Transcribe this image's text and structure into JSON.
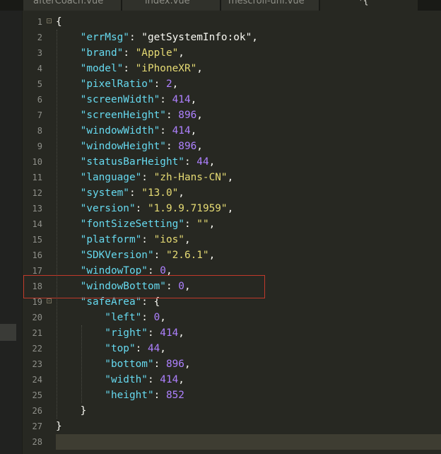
{
  "tabs": [
    {
      "label": "afterCoach.vue",
      "active": false
    },
    {
      "label": "index.vue",
      "active": false
    },
    {
      "label": "mescroll-uni.vue",
      "active": false
    },
    {
      "label": "*{",
      "active": true
    }
  ],
  "lines": [
    {
      "num": "1",
      "code": [
        {
          "t": "p",
          "v": "{"
        }
      ],
      "fold": true
    },
    {
      "num": "2",
      "code": [
        {
          "t": "k",
          "v": "    \"errMsg\""
        },
        {
          "t": "p",
          "v": ": "
        },
        {
          "t": "p",
          "v": "\"getSystemInfo:ok\""
        },
        {
          "t": "p",
          "v": ","
        }
      ]
    },
    {
      "num": "3",
      "code": [
        {
          "t": "k",
          "v": "    \"brand\""
        },
        {
          "t": "p",
          "v": ": "
        },
        {
          "t": "s",
          "v": "\"Apple\""
        },
        {
          "t": "p",
          "v": ","
        }
      ]
    },
    {
      "num": "4",
      "code": [
        {
          "t": "k",
          "v": "    \"model\""
        },
        {
          "t": "p",
          "v": ": "
        },
        {
          "t": "s",
          "v": "\"iPhoneXR\""
        },
        {
          "t": "p",
          "v": ","
        }
      ]
    },
    {
      "num": "5",
      "code": [
        {
          "t": "k",
          "v": "    \"pixelRatio\""
        },
        {
          "t": "p",
          "v": ": "
        },
        {
          "t": "n",
          "v": "2"
        },
        {
          "t": "p",
          "v": ","
        }
      ]
    },
    {
      "num": "6",
      "code": [
        {
          "t": "k",
          "v": "    \"screenWidth\""
        },
        {
          "t": "p",
          "v": ": "
        },
        {
          "t": "n",
          "v": "414"
        },
        {
          "t": "p",
          "v": ","
        }
      ]
    },
    {
      "num": "7",
      "code": [
        {
          "t": "k",
          "v": "    \"screenHeight\""
        },
        {
          "t": "p",
          "v": ": "
        },
        {
          "t": "n",
          "v": "896"
        },
        {
          "t": "p",
          "v": ","
        }
      ]
    },
    {
      "num": "8",
      "code": [
        {
          "t": "k",
          "v": "    \"windowWidth\""
        },
        {
          "t": "p",
          "v": ": "
        },
        {
          "t": "n",
          "v": "414"
        },
        {
          "t": "p",
          "v": ","
        }
      ]
    },
    {
      "num": "9",
      "code": [
        {
          "t": "k",
          "v": "    \"windowHeight\""
        },
        {
          "t": "p",
          "v": ": "
        },
        {
          "t": "n",
          "v": "896"
        },
        {
          "t": "p",
          "v": ","
        }
      ]
    },
    {
      "num": "10",
      "code": [
        {
          "t": "k",
          "v": "    \"statusBarHeight\""
        },
        {
          "t": "p",
          "v": ": "
        },
        {
          "t": "n",
          "v": "44"
        },
        {
          "t": "p",
          "v": ","
        }
      ]
    },
    {
      "num": "11",
      "code": [
        {
          "t": "k",
          "v": "    \"language\""
        },
        {
          "t": "p",
          "v": ": "
        },
        {
          "t": "s",
          "v": "\"zh-Hans-CN\""
        },
        {
          "t": "p",
          "v": ","
        }
      ]
    },
    {
      "num": "12",
      "code": [
        {
          "t": "k",
          "v": "    \"system\""
        },
        {
          "t": "p",
          "v": ": "
        },
        {
          "t": "s",
          "v": "\"13.0\""
        },
        {
          "t": "p",
          "v": ","
        }
      ]
    },
    {
      "num": "13",
      "code": [
        {
          "t": "k",
          "v": "    \"version\""
        },
        {
          "t": "p",
          "v": ": "
        },
        {
          "t": "s",
          "v": "\"1.9.9.71959\""
        },
        {
          "t": "p",
          "v": ","
        }
      ]
    },
    {
      "num": "14",
      "code": [
        {
          "t": "k",
          "v": "    \"fontSizeSetting\""
        },
        {
          "t": "p",
          "v": ": "
        },
        {
          "t": "s",
          "v": "\"\""
        },
        {
          "t": "p",
          "v": ","
        }
      ]
    },
    {
      "num": "15",
      "code": [
        {
          "t": "k",
          "v": "    \"platform\""
        },
        {
          "t": "p",
          "v": ": "
        },
        {
          "t": "s",
          "v": "\"ios\""
        },
        {
          "t": "p",
          "v": ","
        }
      ]
    },
    {
      "num": "16",
      "code": [
        {
          "t": "k",
          "v": "    \"SDKVersion\""
        },
        {
          "t": "p",
          "v": ": "
        },
        {
          "t": "s",
          "v": "\"2.6.1\""
        },
        {
          "t": "p",
          "v": ","
        }
      ]
    },
    {
      "num": "17",
      "code": [
        {
          "t": "k",
          "v": "    \"windowTop\""
        },
        {
          "t": "p",
          "v": ": "
        },
        {
          "t": "n",
          "v": "0"
        },
        {
          "t": "p",
          "v": ","
        }
      ]
    },
    {
      "num": "18",
      "code": [
        {
          "t": "k",
          "v": "    \"windowBottom\""
        },
        {
          "t": "p",
          "v": ": "
        },
        {
          "t": "n",
          "v": "0"
        },
        {
          "t": "p",
          "v": ","
        }
      ]
    },
    {
      "num": "19",
      "code": [
        {
          "t": "k",
          "v": "    \"safeArea\""
        },
        {
          "t": "p",
          "v": ": {"
        }
      ],
      "fold": true
    },
    {
      "num": "20",
      "code": [
        {
          "t": "k",
          "v": "        \"left\""
        },
        {
          "t": "p",
          "v": ": "
        },
        {
          "t": "n",
          "v": "0"
        },
        {
          "t": "p",
          "v": ","
        }
      ]
    },
    {
      "num": "21",
      "code": [
        {
          "t": "k",
          "v": "        \"right\""
        },
        {
          "t": "p",
          "v": ": "
        },
        {
          "t": "n",
          "v": "414"
        },
        {
          "t": "p",
          "v": ","
        }
      ]
    },
    {
      "num": "22",
      "code": [
        {
          "t": "k",
          "v": "        \"top\""
        },
        {
          "t": "p",
          "v": ": "
        },
        {
          "t": "n",
          "v": "44"
        },
        {
          "t": "p",
          "v": ","
        }
      ]
    },
    {
      "num": "23",
      "code": [
        {
          "t": "k",
          "v": "        \"bottom\""
        },
        {
          "t": "p",
          "v": ": "
        },
        {
          "t": "n",
          "v": "896"
        },
        {
          "t": "p",
          "v": ","
        }
      ]
    },
    {
      "num": "24",
      "code": [
        {
          "t": "k",
          "v": "        \"width\""
        },
        {
          "t": "p",
          "v": ": "
        },
        {
          "t": "n",
          "v": "414"
        },
        {
          "t": "p",
          "v": ","
        }
      ]
    },
    {
      "num": "25",
      "code": [
        {
          "t": "k",
          "v": "        \"height\""
        },
        {
          "t": "p",
          "v": ": "
        },
        {
          "t": "n",
          "v": "852"
        }
      ]
    },
    {
      "num": "26",
      "code": [
        {
          "t": "p",
          "v": "    }"
        }
      ]
    },
    {
      "num": "27",
      "code": [
        {
          "t": "p",
          "v": "}"
        }
      ]
    },
    {
      "num": "28",
      "code": [],
      "current": true
    }
  ],
  "highlighted_line": "18",
  "colors": {
    "background": "#272822",
    "key": "#66d9ef",
    "string": "#e6db74",
    "number": "#ae81ff",
    "punctuation": "#f8f8f2",
    "highlight_box": "#c0392b"
  }
}
